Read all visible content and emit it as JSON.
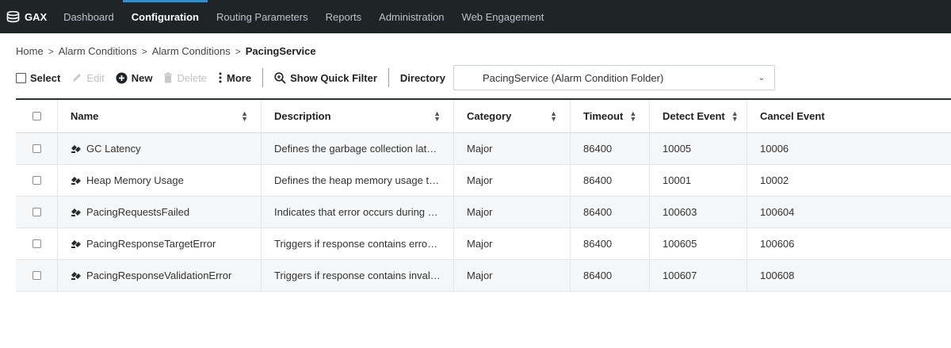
{
  "nav": {
    "brand": "GAX",
    "items": [
      {
        "label": "Dashboard",
        "active": false
      },
      {
        "label": "Configuration",
        "active": true
      },
      {
        "label": "Routing Parameters",
        "active": false
      },
      {
        "label": "Reports",
        "active": false
      },
      {
        "label": "Administration",
        "active": false
      },
      {
        "label": "Web Engagement",
        "active": false
      }
    ]
  },
  "breadcrumb": [
    "Home",
    "Alarm Conditions",
    "Alarm Conditions",
    "PacingService"
  ],
  "toolbar": {
    "select": "Select",
    "edit": "Edit",
    "new": "New",
    "delete": "Delete",
    "more": "More",
    "quick_filter": "Show Quick Filter",
    "directory_label": "Directory",
    "directory_value": "PacingService (Alarm Condition Folder)"
  },
  "table": {
    "columns": [
      "Name",
      "Description",
      "Category",
      "Timeout",
      "Detect Event",
      "Cancel Event"
    ],
    "rows": [
      {
        "name": "GC Latency",
        "description": "Defines the garbage collection latenc...",
        "category": "Major",
        "timeout": "86400",
        "detect": "10005",
        "cancel": "10006"
      },
      {
        "name": "Heap Memory Usage",
        "description": "Defines the heap memory usage thre...",
        "category": "Major",
        "timeout": "86400",
        "detect": "10001",
        "cancel": "10002"
      },
      {
        "name": "PacingRequestsFailed",
        "description": "Indicates that error occurs during pa...",
        "category": "Major",
        "timeout": "86400",
        "detect": "100603",
        "cancel": "100604"
      },
      {
        "name": "PacingResponseTargetError",
        "description": "Triggers if response contains error o...",
        "category": "Major",
        "timeout": "86400",
        "detect": "100605",
        "cancel": "100606"
      },
      {
        "name": "PacingResponseValidationError",
        "description": "Triggers if response contains invalid ...",
        "category": "Major",
        "timeout": "86400",
        "detect": "100607",
        "cancel": "100608"
      }
    ]
  },
  "icons": {
    "brand": "database-stack-icon",
    "edit": "pencil-icon",
    "new": "plus-circle-icon",
    "delete": "trash-icon",
    "more": "vertical-dots-icon",
    "quick_filter": "zoom-in-icon",
    "row": "alarm-condition-icon",
    "sort": "sort-arrows-icon"
  },
  "colors": {
    "nav_bg": "#1f2427",
    "nav_active_indicator": "#2e8fd9",
    "row_stripe": "#f5f6f7"
  }
}
